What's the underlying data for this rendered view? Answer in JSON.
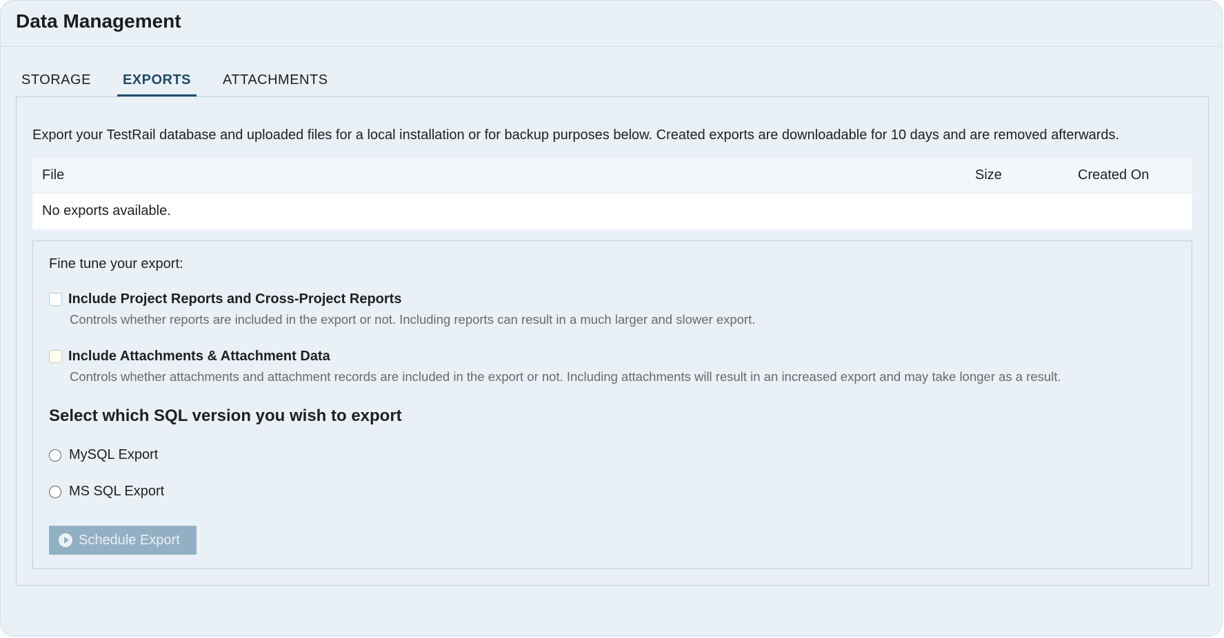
{
  "header": {
    "title": "Data Management"
  },
  "tabs": [
    {
      "label": "STORAGE",
      "active": false
    },
    {
      "label": "EXPORTS",
      "active": true
    },
    {
      "label": "ATTACHMENTS",
      "active": false
    }
  ],
  "intro": "Export your TestRail database and uploaded files for a local installation or for backup purposes below. Created exports are downloadable for 10 days and are removed afterwards.",
  "table": {
    "columns": [
      "File",
      "Size",
      "Created On"
    ],
    "empty_message": "No exports available."
  },
  "options": {
    "title": "Fine tune your export:",
    "reports": {
      "label": "Include Project Reports and Cross-Project Reports",
      "description": "Controls whether reports are included in the export or not. Including reports can result in a much larger and slower export.",
      "checked": false
    },
    "attachments": {
      "label": "Include Attachments & Attachment Data",
      "description": "Controls whether attachments and attachment records are included in the export or not. Including attachments will result in an increased export and may take longer as a result.",
      "checked": false
    },
    "sql_heading": "Select which SQL version you wish to export",
    "sql_versions": [
      {
        "label": "MySQL Export",
        "selected": false
      },
      {
        "label": "MS SQL Export",
        "selected": false
      }
    ],
    "schedule_button": "Schedule Export"
  },
  "colors": {
    "accent": "#234a66",
    "button_disabled": "#93afc4",
    "background": "#e9f0f6"
  },
  "icons": {
    "button_icon": "play-circle-icon"
  }
}
